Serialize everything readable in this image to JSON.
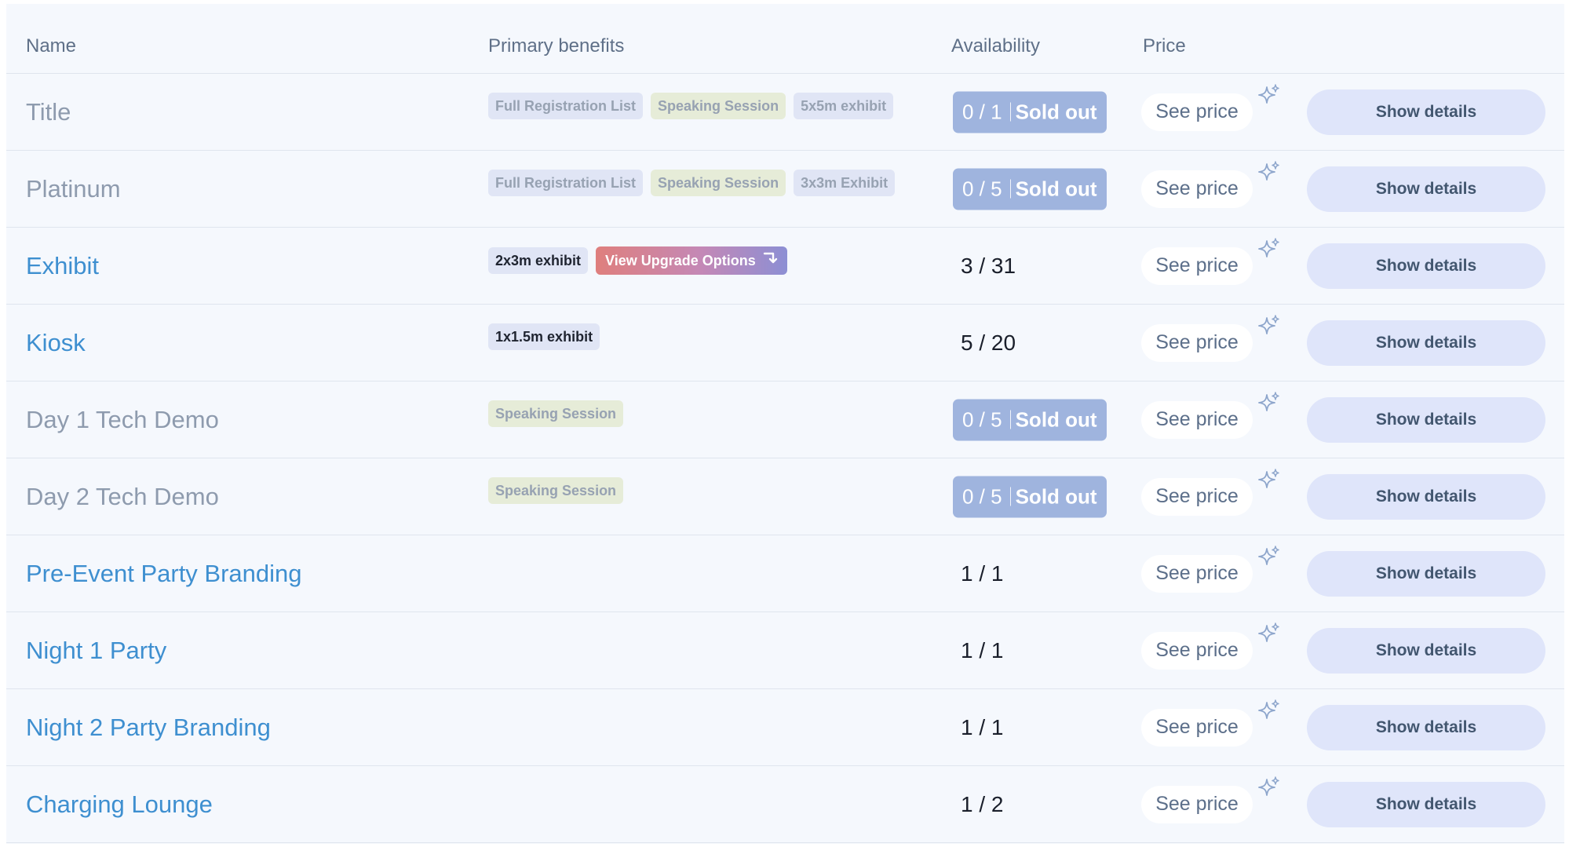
{
  "header": {
    "name": "Name",
    "benefits": "Primary benefits",
    "availability": "Availability",
    "price": "Price"
  },
  "colors": {
    "name_active": "#3e8fd0",
    "name_sold_out": "#8e9bae",
    "sold_out_badge": "#9fb4de",
    "upgrade_gradient": [
      "#df7f7d",
      "#c488b6",
      "#8c8fd4"
    ],
    "details_button": "#dfe5fa"
  },
  "icons": {
    "price_hint": "sparkle-icon",
    "upgrade": "arrow-turn-down-icon"
  },
  "rows": [
    {
      "name": "Title",
      "state": "sold",
      "benefits": [
        {
          "label": "Full Registration List",
          "style": "lav-dim"
        },
        {
          "label": "Speaking Session",
          "style": "grn"
        },
        {
          "label": "5x5m exhibit",
          "style": "lav-dim"
        }
      ],
      "availability": "0 / 1",
      "sold_out_label": "Sold out",
      "price_label": "See price",
      "details_label": "Show details"
    },
    {
      "name": "Platinum",
      "state": "sold",
      "benefits": [
        {
          "label": "Full Registration List",
          "style": "lav-dim"
        },
        {
          "label": "Speaking Session",
          "style": "grn"
        },
        {
          "label": "3x3m Exhibit",
          "style": "lav-dim"
        }
      ],
      "availability": "0 / 5",
      "sold_out_label": "Sold out",
      "price_label": "See price",
      "details_label": "Show details"
    },
    {
      "name": "Exhibit",
      "state": "active",
      "benefits": [
        {
          "label": "2x3m exhibit",
          "style": "lav"
        },
        {
          "label": "View Upgrade Options",
          "style": "upgrade"
        }
      ],
      "availability": "3 / 31",
      "price_label": "See price",
      "details_label": "Show details"
    },
    {
      "name": "Kiosk",
      "state": "active",
      "benefits": [
        {
          "label": "1x1.5m exhibit",
          "style": "lav"
        }
      ],
      "availability": "5 / 20",
      "price_label": "See price",
      "details_label": "Show details"
    },
    {
      "name": "Day 1 Tech Demo",
      "state": "sold",
      "benefits": [
        {
          "label": "Speaking Session",
          "style": "grn"
        }
      ],
      "availability": "0 / 5",
      "sold_out_label": "Sold out",
      "price_label": "See price",
      "details_label": "Show details"
    },
    {
      "name": "Day 2 Tech Demo",
      "state": "sold",
      "benefits": [
        {
          "label": "Speaking Session",
          "style": "grn"
        }
      ],
      "availability": "0 / 5",
      "sold_out_label": "Sold out",
      "price_label": "See price",
      "details_label": "Show details"
    },
    {
      "name": "Pre-Event Party Branding",
      "state": "active",
      "benefits": [],
      "availability": "1 / 1",
      "price_label": "See price",
      "details_label": "Show details"
    },
    {
      "name": "Night 1 Party",
      "state": "active",
      "benefits": [],
      "availability": "1 / 1",
      "price_label": "See price",
      "details_label": "Show details"
    },
    {
      "name": "Night 2 Party Branding",
      "state": "active",
      "benefits": [],
      "availability": "1 / 1",
      "price_label": "See price",
      "details_label": "Show details"
    },
    {
      "name": "Charging Lounge",
      "state": "active",
      "benefits": [],
      "availability": "1 / 2",
      "price_label": "See price",
      "details_label": "Show details"
    }
  ]
}
